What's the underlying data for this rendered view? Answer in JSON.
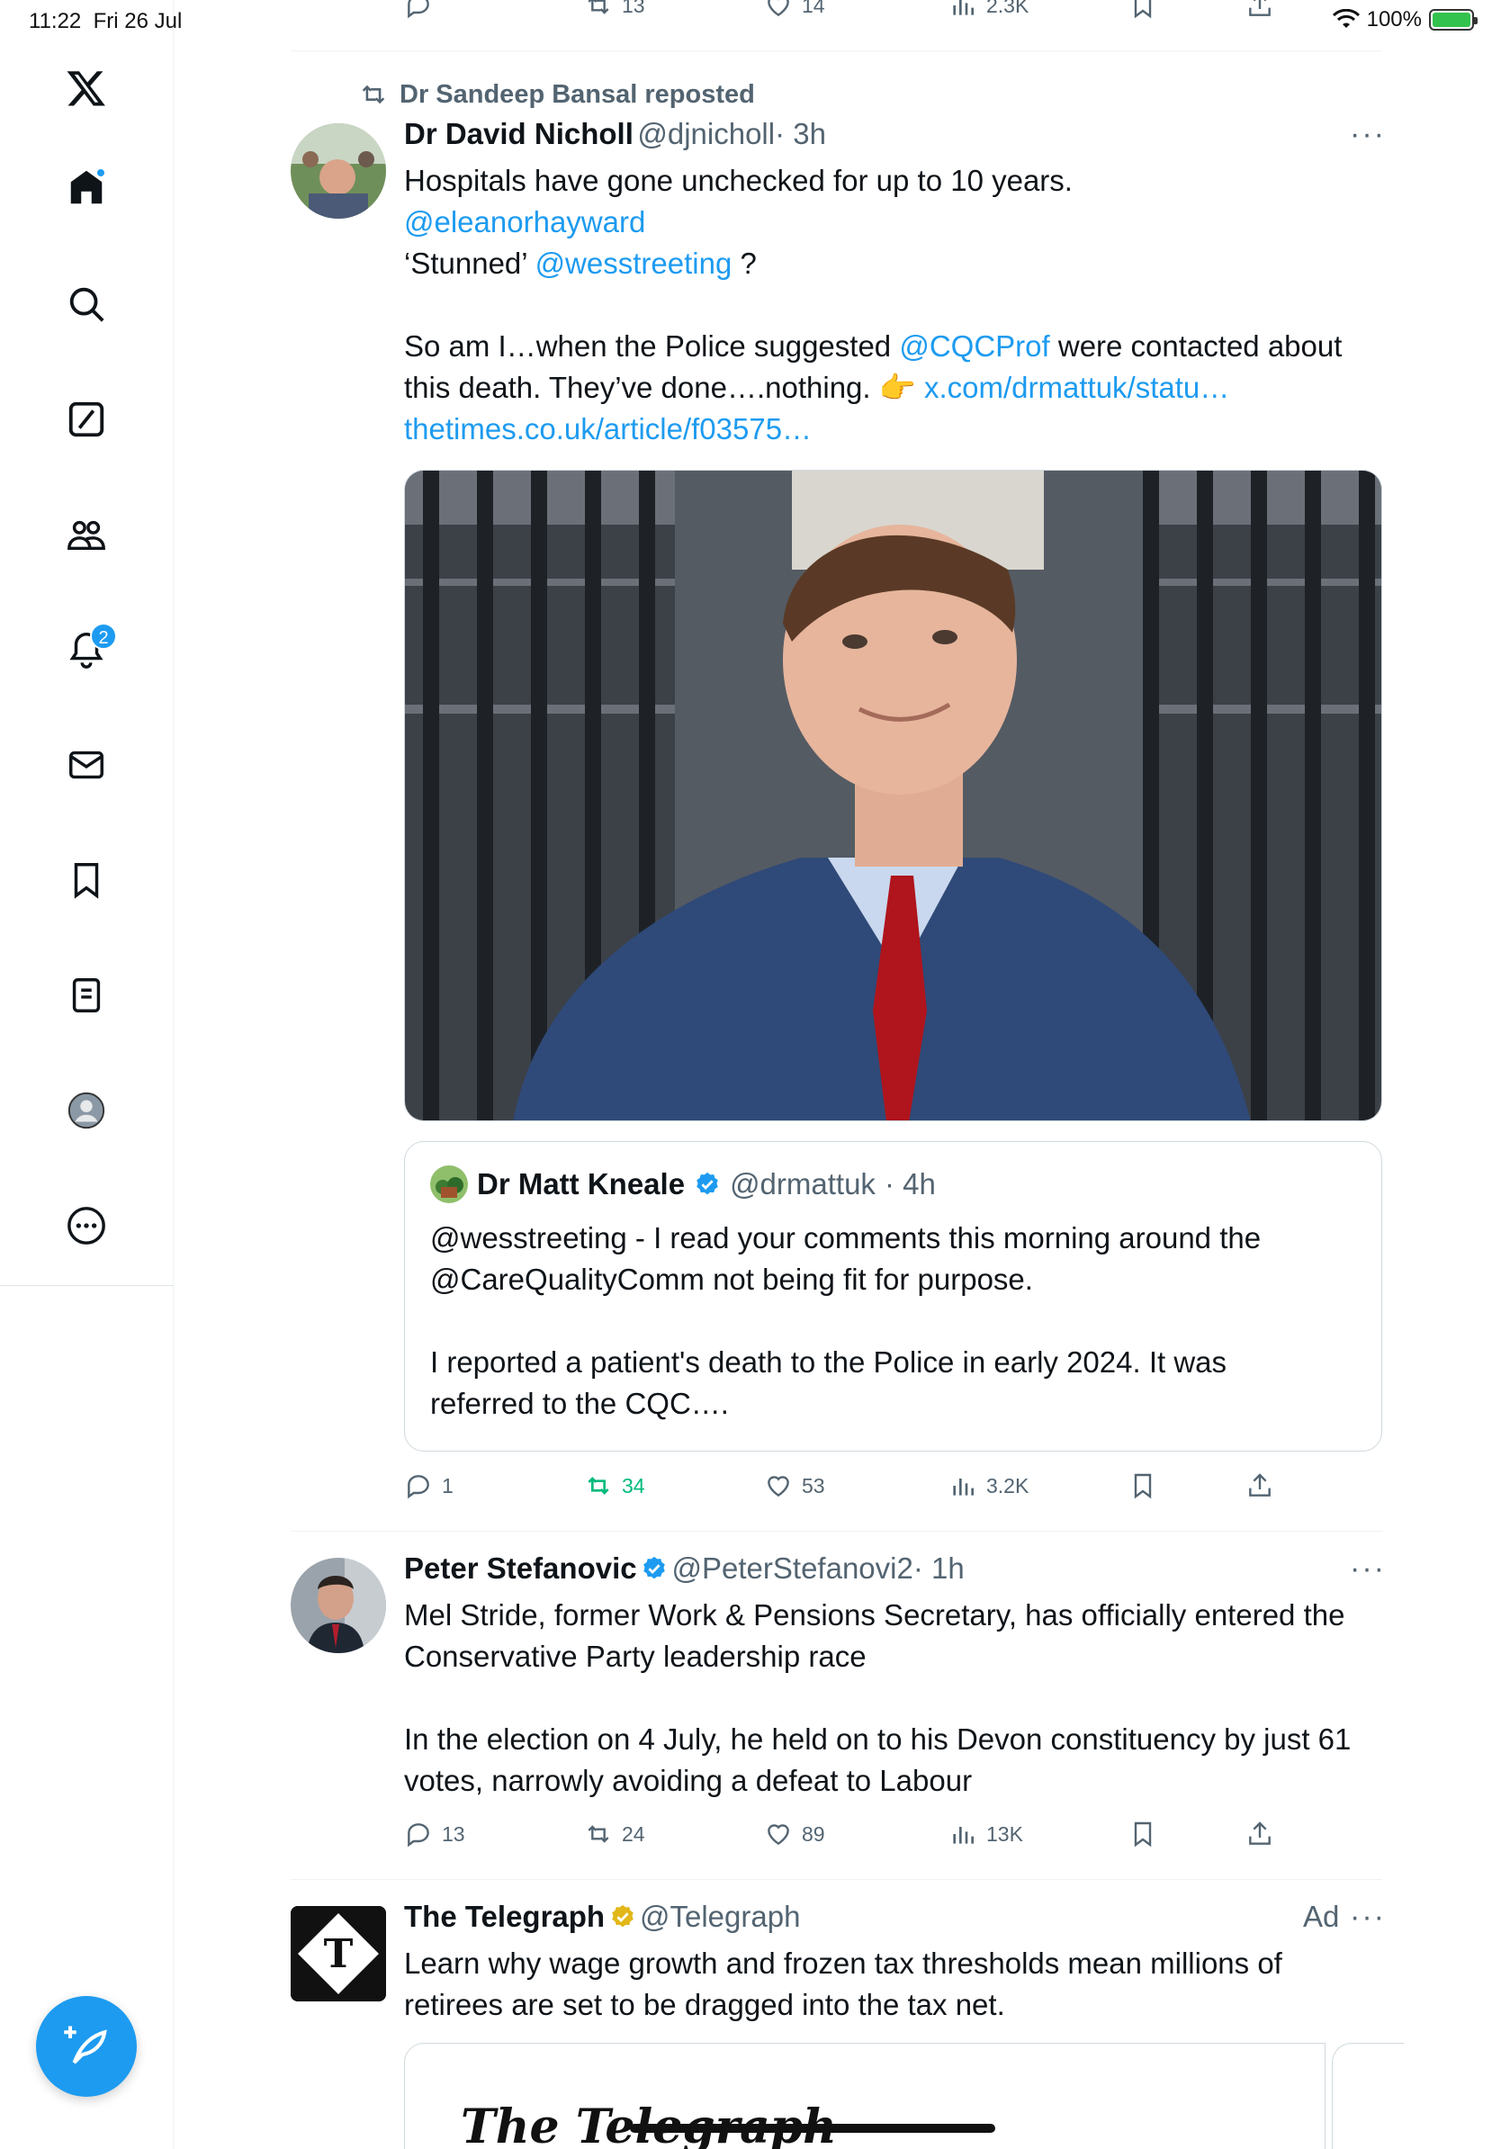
{
  "status_bar": {
    "time": "11:22",
    "date": "Fri 26 Jul",
    "battery": "100%"
  },
  "sidebar": {
    "items": [
      {
        "name": "x-logo"
      },
      {
        "name": "home"
      },
      {
        "name": "search"
      },
      {
        "name": "grok"
      },
      {
        "name": "communities"
      },
      {
        "name": "notifications",
        "badge": "2"
      },
      {
        "name": "messages"
      },
      {
        "name": "bookmarks"
      },
      {
        "name": "lists"
      },
      {
        "name": "profile"
      },
      {
        "name": "more"
      }
    ]
  },
  "top_actions": {
    "reposts": "13",
    "likes": "14",
    "views": "2.3K"
  },
  "tweet1": {
    "repost_label": "Dr Sandeep Bansal reposted",
    "author_name": "Dr David Nicholl",
    "author_handle": "@djnicholl",
    "time": "· 3h",
    "line1": "Hospitals have gone unchecked for up to 10 years.",
    "mention1": "@eleanorhayward",
    "line3_pre": "‘Stunned’ ",
    "mention2": "@wesstreeting",
    "line3_post": " ?",
    "line4_pre": "So am I…when the Police suggested ",
    "mention3": "@CQCProf",
    "line4_post": " were contacted about",
    "line5_pre": "this death. They’ve done….nothing. 👉 ",
    "link1": "x.com/drmattuk/statu…",
    "link2": "thetimes.co.uk/article/f03575…",
    "quote": {
      "author_name": "Dr Matt Kneale",
      "author_handle": "@drmattuk",
      "time": "· 4h",
      "line1": "@wesstreeting - I read your comments this morning around the",
      "line2": "@CareQualityComm not being fit for purpose.",
      "line3": "I reported a patient's death to the Police in early 2024. It was",
      "line4": "referred to the CQC…."
    },
    "stats": {
      "replies": "1",
      "reposts": "34",
      "likes": "53",
      "views": "3.2K"
    }
  },
  "tweet2": {
    "author_name": "Peter Stefanovic",
    "author_handle": "@PeterStefanovi2",
    "time": "· 1h",
    "line1": "Mel Stride, former Work & Pensions Secretary, has officially entered the",
    "line2": "Conservative Party leadership race",
    "line3": "In the election on 4 July, he held on to his Devon constituency by just 61",
    "line4": "votes, narrowly avoiding a defeat to Labour",
    "stats": {
      "replies": "13",
      "reposts": "24",
      "likes": "89",
      "views": "13K"
    }
  },
  "tweet3": {
    "author_name": "The Telegraph",
    "author_handle": "@Telegraph",
    "ad_label": "Ad",
    "line1": "Learn why wage growth and frozen tax thresholds mean millions of",
    "line2": "retirees are set to be dragged into the tax net.",
    "card_title": "The Telegraph"
  },
  "colors": {
    "accent": "#1d9bf0",
    "repost_green": "#00ba7c",
    "muted": "#536471",
    "verified_gold": "#e2b719"
  }
}
